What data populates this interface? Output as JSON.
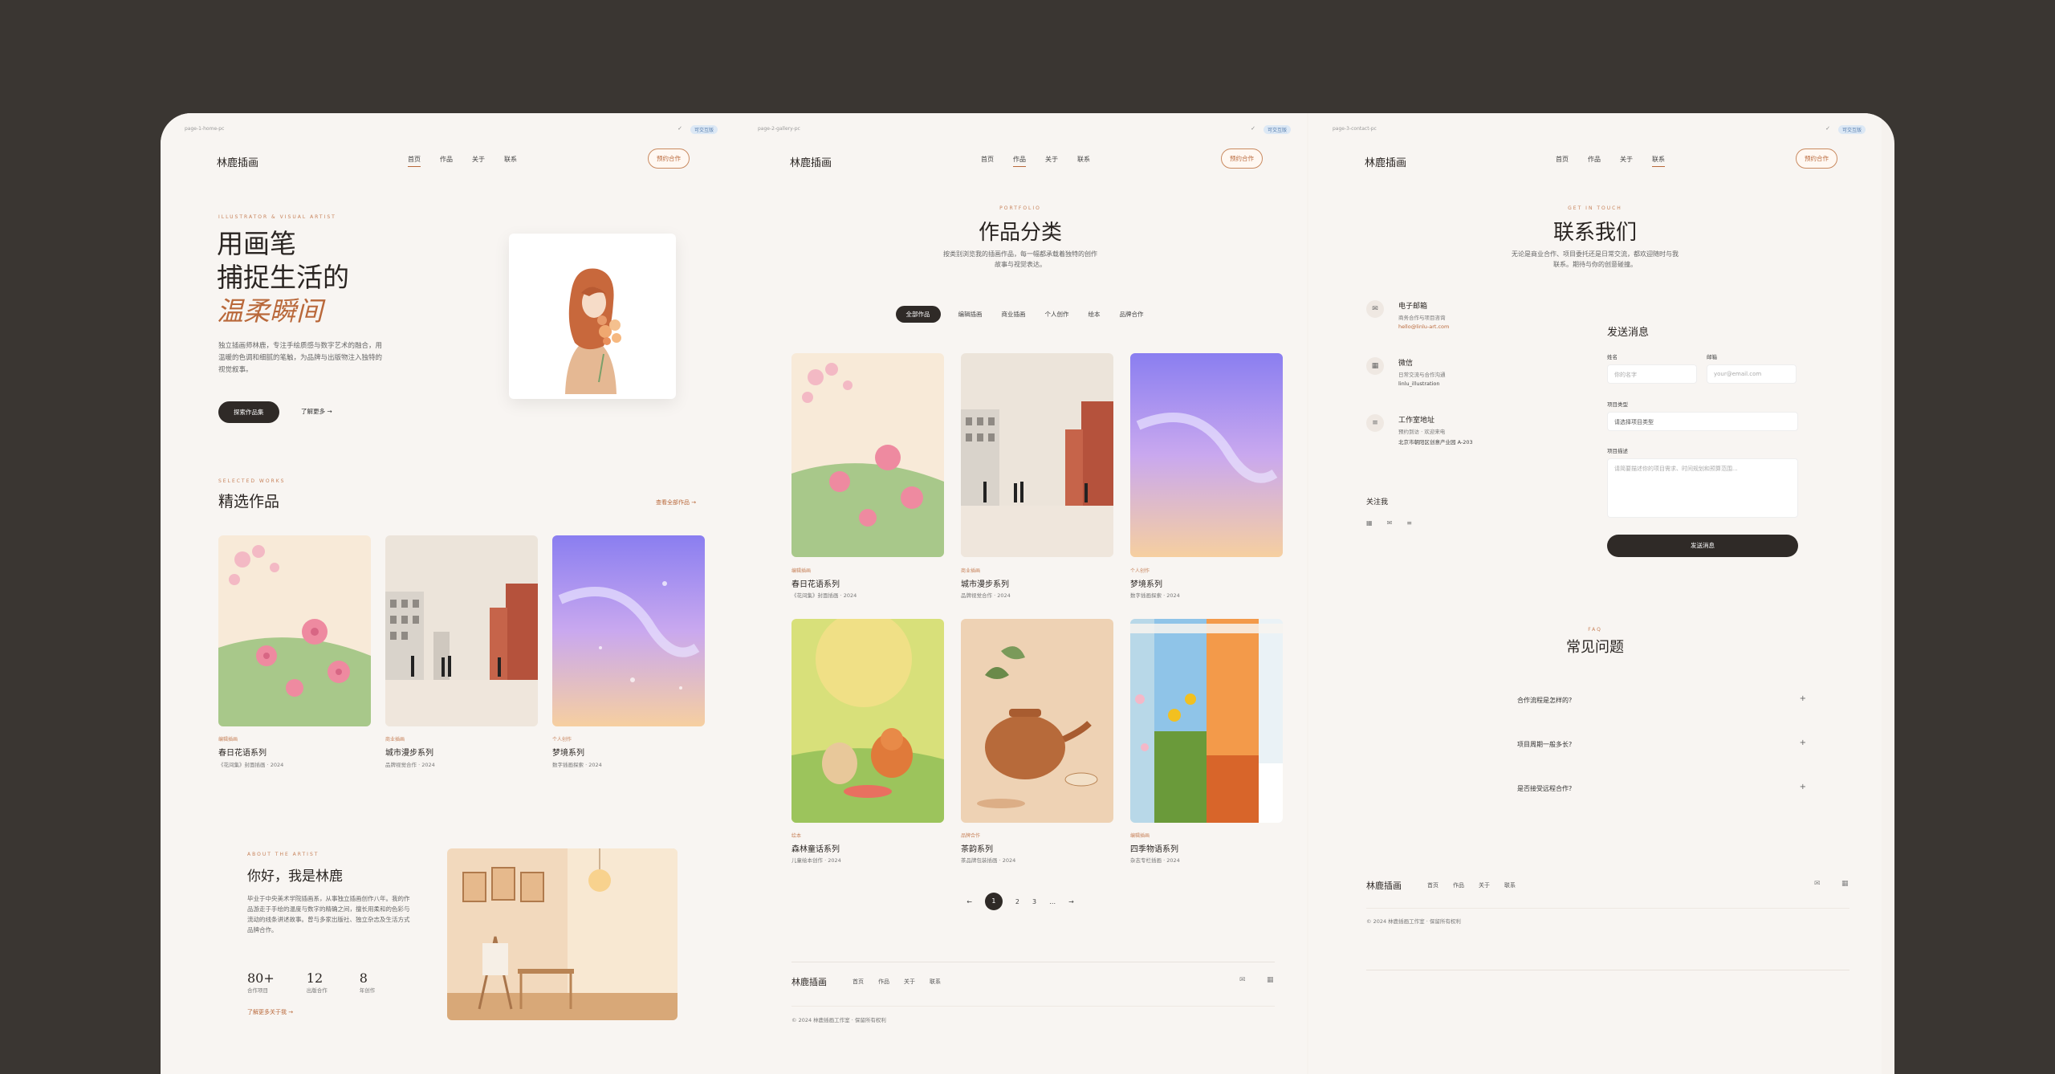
{
  "pages": {
    "home": {
      "url": "page-1-home-pc",
      "badge": "可交互版",
      "logo": "林鹿插画",
      "nav": [
        "首页",
        "作品",
        "关于",
        "联系"
      ],
      "active_nav": 0,
      "cta": "预约合作",
      "hero": {
        "eyebrow": "ILLUSTRATOR & VISUAL ARTIST",
        "title_line1": "用画笔",
        "title_line2": "捕捉生活的",
        "title_accent": "温柔瞬间",
        "desc": "独立插画师林鹿，专注手绘质感与数字艺术的融合，用温暖的色调和细腻的笔触，为品牌与出版物注入独特的视觉叙事。",
        "primary_btn": "探索作品集",
        "secondary_link": "了解更多"
      },
      "selected": {
        "eyebrow": "SELECTED WORKS",
        "title": "精选作品",
        "view_all": "查看全部作品",
        "items": [
          {
            "tag": "编辑插画",
            "title": "春日花语系列",
            "sub": "《花间集》封面插画 · 2024"
          },
          {
            "tag": "商业插画",
            "title": "城市漫步系列",
            "sub": "品牌视觉合作 · 2024"
          },
          {
            "tag": "个人创作",
            "title": "梦境系列",
            "sub": "数字插画探索 · 2024"
          }
        ]
      },
      "about": {
        "eyebrow": "ABOUT THE ARTIST",
        "title": "你好，我是林鹿",
        "desc": "毕业于中央美术学院插画系，从事独立插画创作八年。我的作品游走于手绘的温度与数字的精确之间，擅长用柔和的色彩与流动的线条讲述故事。曾与多家出版社、独立杂志及生活方式品牌合作。",
        "stats": [
          {
            "num": "80+",
            "label": "合作项目"
          },
          {
            "num": "12",
            "label": "出版合作"
          },
          {
            "num": "8",
            "label": "年创作"
          }
        ],
        "link": "了解更多关于我"
      }
    },
    "gallery": {
      "url": "page-2-gallery-pc",
      "badge": "可交互版",
      "logo": "林鹿插画",
      "nav": [
        "首页",
        "作品",
        "关于",
        "联系"
      ],
      "active_nav": 1,
      "cta": "预约合作",
      "eyebrow": "PORTFOLIO",
      "title": "作品分类",
      "desc_line1": "按类别浏览我的插画作品，每一幅都承载着独特的创作",
      "desc_line2": "故事与视觉表达。",
      "filters": [
        "全部作品",
        "编辑插画",
        "商业插画",
        "个人创作",
        "绘本",
        "品牌合作"
      ],
      "active_filter": 0,
      "items": [
        {
          "tag": "编辑插画",
          "title": "春日花语系列",
          "sub": "《花间集》封面插画 · 2024"
        },
        {
          "tag": "商业插画",
          "title": "城市漫步系列",
          "sub": "品牌视觉合作 · 2024"
        },
        {
          "tag": "个人创作",
          "title": "梦境系列",
          "sub": "数字插画探索 · 2024"
        },
        {
          "tag": "绘本",
          "title": "森林童话系列",
          "sub": "儿童绘本创作 · 2024"
        },
        {
          "tag": "品牌合作",
          "title": "茶韵系列",
          "sub": "茶品牌包装插画 · 2024"
        },
        {
          "tag": "编辑插画",
          "title": "四季物语系列",
          "sub": "杂志专栏插画 · 2024"
        }
      ],
      "pagination": [
        "←",
        "1",
        "2",
        "3",
        "…",
        "→"
      ],
      "footer": {
        "logo": "林鹿插画",
        "links": [
          "首页",
          "作品",
          "关于",
          "联系"
        ],
        "copyright": "© 2024 林鹿插画工作室 · 保留所有权利"
      }
    },
    "contact": {
      "url": "page-3-contact-pc",
      "badge": "可交互版",
      "logo": "林鹿插画",
      "nav": [
        "首页",
        "作品",
        "关于",
        "联系"
      ],
      "active_nav": 3,
      "cta": "预约合作",
      "eyebrow": "GET IN TOUCH",
      "title": "联系我们",
      "desc_line1": "无论是商业合作、项目委托还是日常交流，都欢迎随时与我",
      "desc_line2": "联系。期待与你的创意碰撞。",
      "info": [
        {
          "title": "电子邮箱",
          "sub": "商务合作与项目咨询",
          "value": "hello@linlu-art.com"
        },
        {
          "title": "微信",
          "sub": "日常交流与合作沟通",
          "value": "linlu_illustration"
        },
        {
          "title": "工作室地址",
          "sub": "预约到访 · 欢迎来电",
          "value": "北京市朝阳区创意产业园 A-203"
        }
      ],
      "follow": "关注我",
      "form": {
        "title": "发送消息",
        "name_label": "姓名",
        "name_placeholder": "你的名字",
        "email_label": "邮箱",
        "email_placeholder": "your@email.com",
        "type_label": "项目类型",
        "type_value": "请选择项目类型",
        "desc_label": "项目描述",
        "desc_placeholder": "请简要描述你的项目需求、时间规划和预算范围...",
        "submit": "发送消息"
      },
      "faq": {
        "eyebrow": "FAQ",
        "title": "常见问题",
        "items": [
          "合作流程是怎样的?",
          "项目周期一般多长?",
          "是否接受远程合作?"
        ]
      },
      "footer": {
        "logo": "林鹿插画",
        "links": [
          "首页",
          "作品",
          "关于",
          "联系"
        ],
        "copyright": "© 2024 林鹿插画工作室 · 保留所有权利"
      }
    }
  },
  "colors": {
    "accent": "#b9683a",
    "dark": "#2f2a27",
    "bg": "#f8f5f2"
  }
}
